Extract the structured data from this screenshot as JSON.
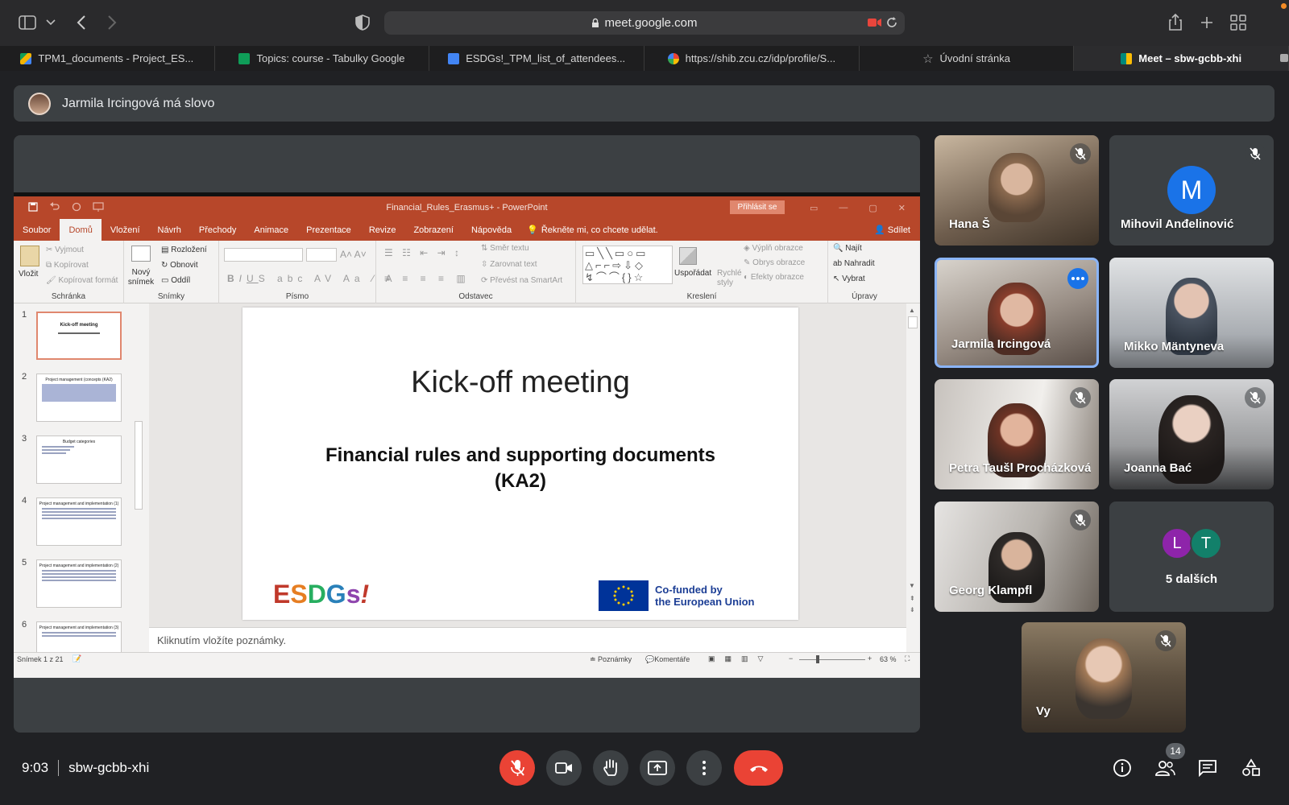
{
  "browser": {
    "url": "meet.google.com",
    "tabs": [
      {
        "label": "TPM1_documents - Project_ES...",
        "favicon_color": "#1a73e8"
      },
      {
        "label": "Topics: course - Tabulky Google",
        "favicon_color": "#0f9d58"
      },
      {
        "label": "ESDGs!_TPM_list_of_attendees...",
        "favicon_color": "#4285f4"
      },
      {
        "label": "https://shib.zcu.cz/idp/profile/S...",
        "favicon_color": "#ea4335"
      },
      {
        "label": "Úvodní stránka",
        "favicon_color": "#9aa0a6"
      },
      {
        "label": "Meet – sbw-gcbb-xhi",
        "favicon_color": "#00897b"
      }
    ]
  },
  "banner": {
    "text": "Jarmila Ircingová má slovo"
  },
  "powerpoint": {
    "window_title": "Financial_Rules_Erasmus+  -  PowerPoint",
    "signin_label": "Přihlásit se",
    "ribbon_tabs": [
      "Soubor",
      "Domů",
      "Vložení",
      "Návrh",
      "Přechody",
      "Animace",
      "Prezentace",
      "Revize",
      "Zobrazení",
      "Nápověda"
    ],
    "tell_me": "Řekněte mi, co chcete udělat.",
    "share": "Sdílet",
    "ribbon": {
      "clipboard": {
        "name": "Schránka",
        "paste": "Vložit",
        "cut": "Vyjmout",
        "copy": "Kopírovat",
        "format": "Kopírovat formát"
      },
      "slides": {
        "name": "Snímky",
        "new": "Nový snímek",
        "layout": "Rozložení",
        "reset": "Obnovit",
        "section": "Oddíl"
      },
      "font": {
        "name": "Písmo"
      },
      "paragraph": {
        "name": "Odstavec",
        "direction": "Směr textu",
        "align": "Zarovnat text",
        "smartart": "Převést na SmartArt"
      },
      "drawing": {
        "name": "Kreslení",
        "arrange": "Uspořádat",
        "quick": "Rychlé styly",
        "fill": "Výplň obrazce",
        "outline": "Obrys obrazce",
        "effects": "Efekty obrazce"
      },
      "editing": {
        "name": "Úpravy",
        "find": "Najít",
        "replace": "Nahradit",
        "select": "Vybrat"
      }
    },
    "thumbnails": [
      {
        "num": "1",
        "title": "Kick-off meeting"
      },
      {
        "num": "2",
        "title": "Project management (concepts (KA2)"
      },
      {
        "num": "3",
        "title": "Budget categories"
      },
      {
        "num": "4",
        "title": "Project management and implementation (1)"
      },
      {
        "num": "5",
        "title": "Project management and implementation (2)"
      },
      {
        "num": "6",
        "title": "Project management and implementation (3)"
      }
    ],
    "slide": {
      "title": "Kick-off meeting",
      "subtitle_line1": "Financial rules and supporting documents",
      "subtitle_line2": "(KA2)",
      "logo_text": "ESDGs!",
      "eu_line1": "Co-funded by",
      "eu_line2": "the European Union"
    },
    "notes_placeholder": "Kliknutím vložíte poznámky.",
    "status": {
      "slide_counter": "Snímek 1 z 21",
      "notes": "Poznámky",
      "comments": "Komentáře",
      "zoom": "63 %"
    }
  },
  "participants": [
    {
      "name": "Hana Š",
      "muted": true
    },
    {
      "name": "Mihovil Anđelinović",
      "muted": true,
      "initial": "M",
      "avatar_color": "#1a73e8"
    },
    {
      "name": "Jarmila Ircingová",
      "muted": false,
      "speaking": true
    },
    {
      "name": "Mikko Mäntyneva",
      "muted": false
    },
    {
      "name": "Petra Taušl Procházková",
      "muted": true
    },
    {
      "name": "Joanna Bać",
      "muted": true
    },
    {
      "name": "Georg Klampfl",
      "muted": true
    },
    {
      "name": "Vy",
      "muted": true
    }
  ],
  "others": {
    "label": "5 dalších",
    "avatars": [
      {
        "letter": "L",
        "color": "#8e24aa"
      },
      {
        "letter": "T",
        "color": "#12806a"
      }
    ]
  },
  "meeting": {
    "time": "9:03",
    "code": "sbw-gcbb-xhi",
    "participant_count": "14"
  }
}
